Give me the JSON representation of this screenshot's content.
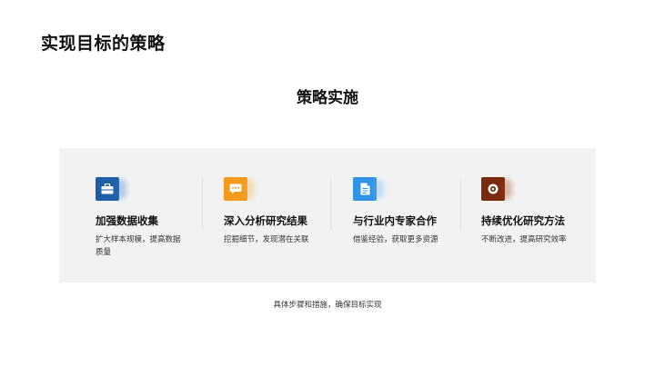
{
  "slide": {
    "title": "实现目标的策略",
    "section_heading": "策略实施",
    "footer_note": "具体步骤和措施，确保目标实现"
  },
  "cards": [
    {
      "icon": "briefcase-icon",
      "color": "#1f5fa8",
      "title": "加强数据收集",
      "desc": "扩大样本规模，提高数据质量"
    },
    {
      "icon": "chat-icon",
      "color": "#f39a1c",
      "title": "深入分析研究结果",
      "desc": "挖掘细节，发现潜在关联"
    },
    {
      "icon": "document-icon",
      "color": "#2f93e8",
      "title": "与行业内专家合作",
      "desc": "借鉴经验，获取更多资源"
    },
    {
      "icon": "target-icon",
      "color": "#7a2a0e",
      "title": "持续优化研究方法",
      "desc": "不断改进，提高研究效率"
    }
  ]
}
